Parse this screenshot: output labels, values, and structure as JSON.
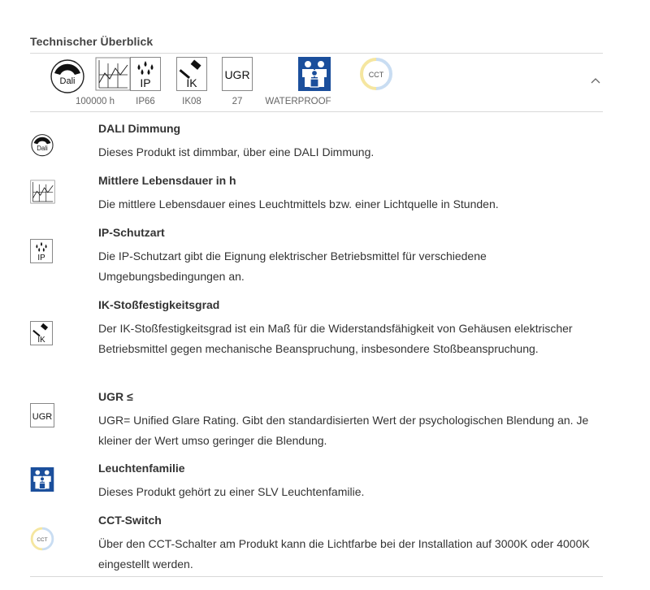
{
  "section": {
    "title": "Technischer Überblick"
  },
  "overview": {
    "icons": [
      {
        "name": "dali-icon",
        "label": ""
      },
      {
        "name": "lifetime-icon",
        "label": "100000 h"
      },
      {
        "name": "ip-icon",
        "label": "IP66",
        "text": "IP"
      },
      {
        "name": "ik-icon",
        "label": "IK08",
        "text": "IK"
      },
      {
        "name": "ugr-icon",
        "label": "27",
        "text": "UGR"
      },
      {
        "name": "family-icon",
        "label": "WATERPROOF"
      },
      {
        "name": "cct-icon",
        "label": "",
        "text": "CCT"
      }
    ],
    "dali_text": "Dali",
    "collapse_icon": "chevron-up-icon"
  },
  "details": [
    {
      "title": "DALI Dimmung",
      "text": "Dieses Produkt ist dimmbar, über eine DALI Dimmung."
    },
    {
      "title": "Mittlere Lebensdauer in h",
      "text": "Die mittlere Lebensdauer eines Leuchtmittels bzw. einer Lichtquelle in Stunden."
    },
    {
      "title": "IP-Schutzart",
      "text": "Die IP-Schutzart gibt die Eignung elektrischer Betriebsmittel für verschiedene Umgebungsbedingungen an."
    },
    {
      "title": "IK-Stoßfestigkeitsgrad",
      "text": "Der IK-Stoßfestigkeitsgrad ist ein Maß für die Widerstandsfähigkeit von Gehäusen elektrischer Betriebsmittel gegen mechanische Beanspruchung, insbesondere Stoßbeanspruchung."
    },
    {
      "title": "UGR ≤",
      "text": "UGR= Unified Glare Rating. Gibt den standardisierten Wert der psychologischen Blendung an. Je kleiner der Wert umso geringer die Blendung."
    },
    {
      "title": "Leuchtenfamilie",
      "text": "Dieses Produkt gehört zu einer SLV Leuchtenfamilie."
    },
    {
      "title": "CCT-Switch",
      "text": "Über den CCT-Schalter am Produkt kann die Lichtfarbe bei der Installation auf 3000K oder 4000K eingestellt werden."
    }
  ],
  "colors": {
    "family_blue": "#1b4f9c",
    "divider": "#d9d9d9",
    "cct_ring_yellow": "#f5e6a0",
    "cct_ring_blue": "#c9ddf2"
  }
}
